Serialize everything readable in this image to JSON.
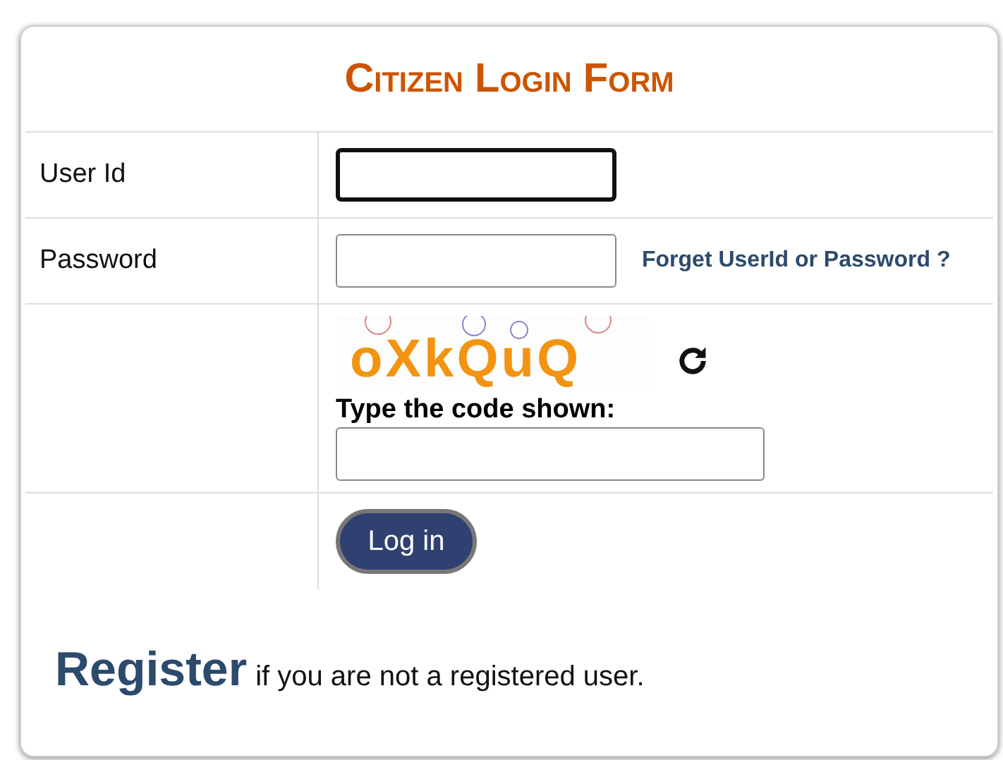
{
  "title": "Citizen Login Form",
  "fields": [
    {
      "label": "User Id",
      "focused": true
    },
    {
      "label": "Password",
      "focused": false,
      "link": "Forget UserId or Password ?"
    }
  ],
  "captcha": {
    "code": "oXkQuQ",
    "prompt": "Type the code shown:"
  },
  "button": "Log in",
  "register": {
    "link": "Register",
    "text": "if you are not a registered user."
  }
}
